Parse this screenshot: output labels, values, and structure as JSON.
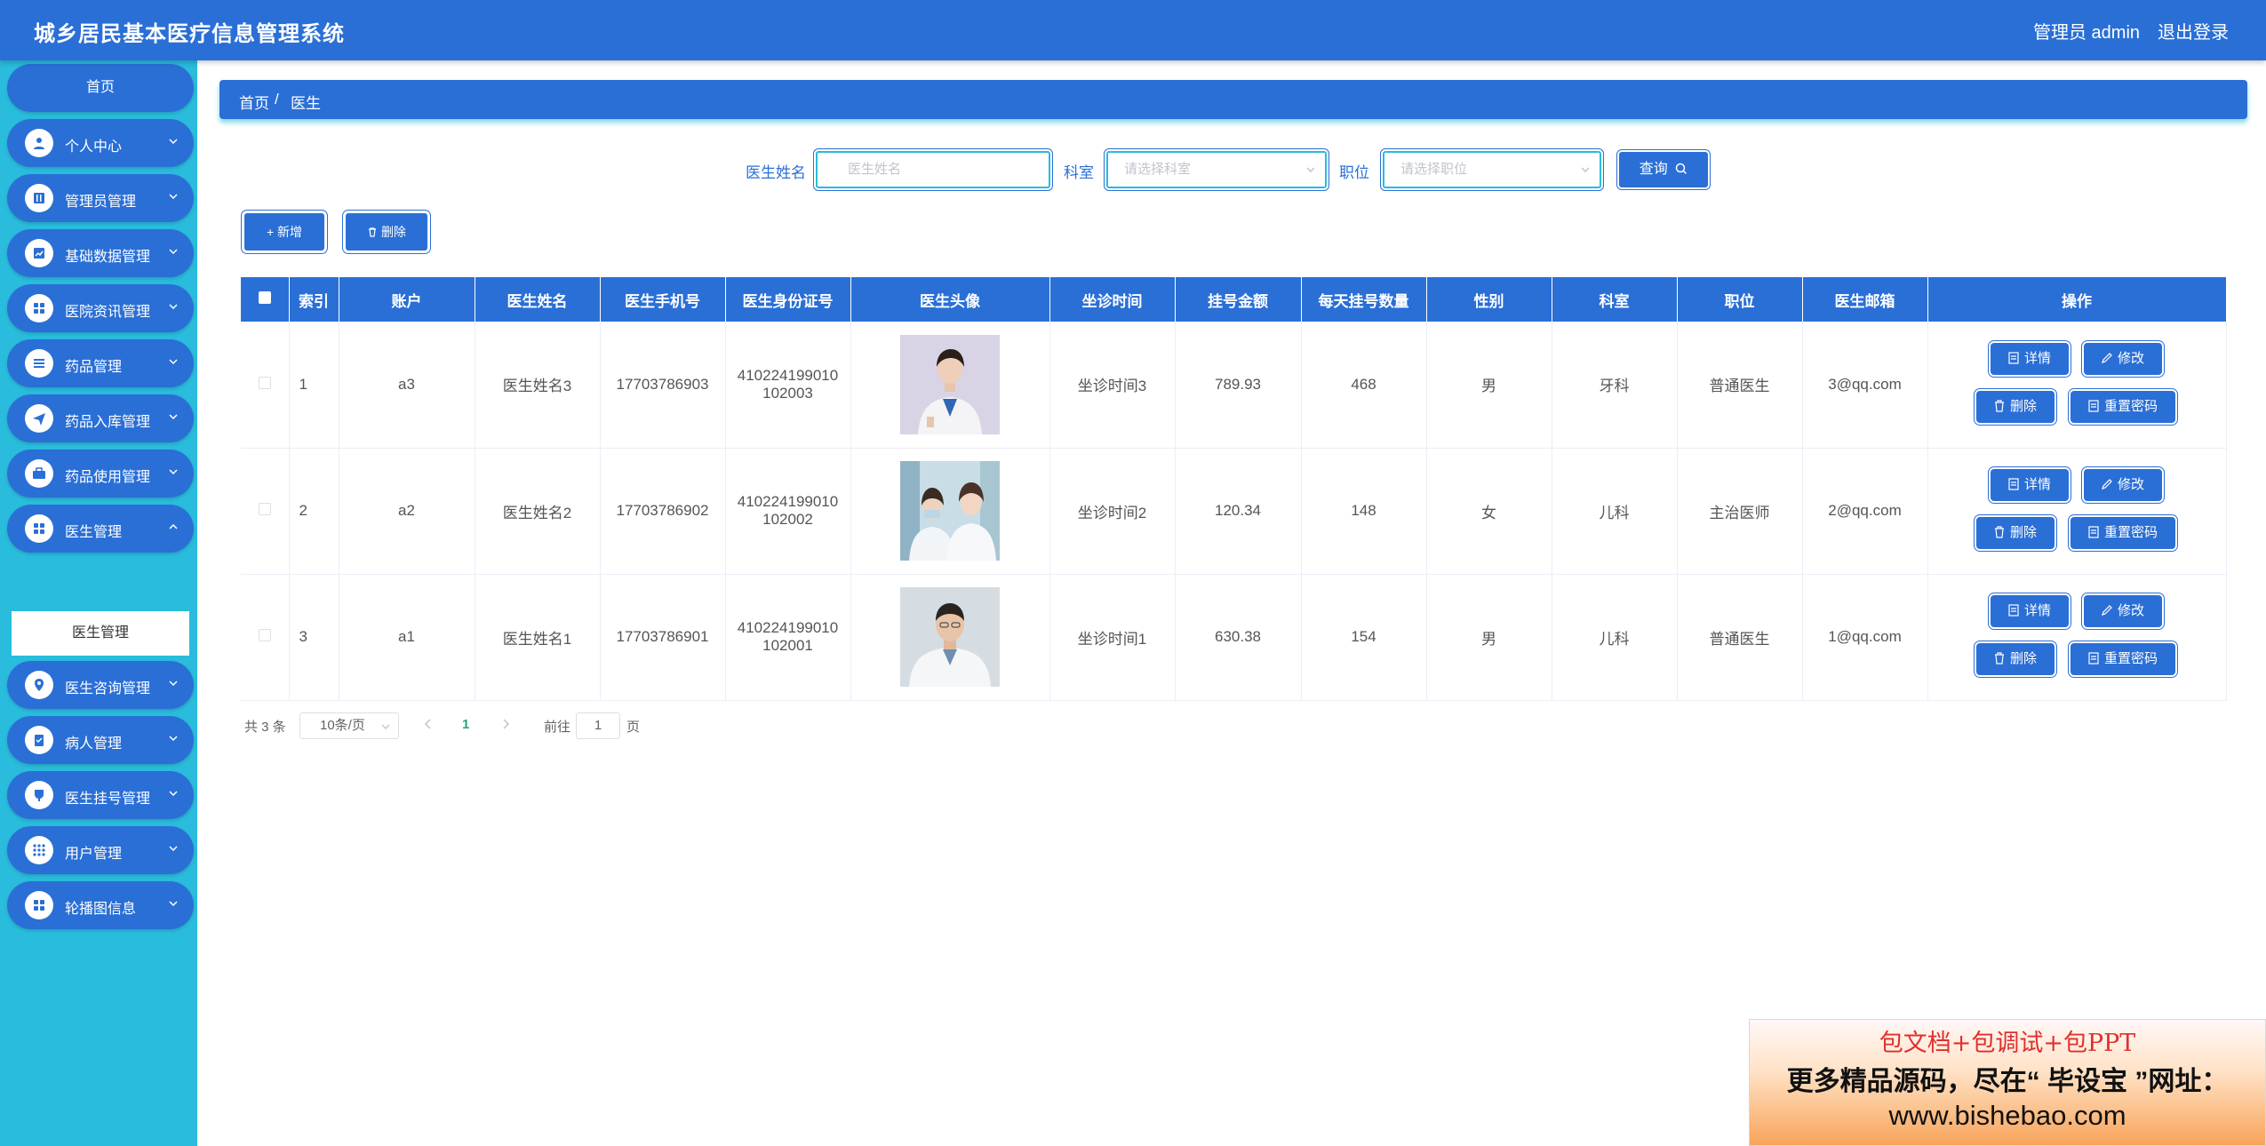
{
  "app": {
    "title": "城乡居民基本医疗信息管理系统",
    "admin_label": "管理员 admin",
    "logout_label": "退出登录"
  },
  "sidebar": {
    "home_label": "首页",
    "items": [
      {
        "label": "个人中心",
        "icon": "user-icon"
      },
      {
        "label": "管理员管理",
        "icon": "book-icon"
      },
      {
        "label": "基础数据管理",
        "icon": "chart-icon"
      },
      {
        "label": "医院资讯管理",
        "icon": "grid-icon"
      },
      {
        "label": "药品管理",
        "icon": "sliders-icon"
      },
      {
        "label": "药品入库管理",
        "icon": "send-icon"
      },
      {
        "label": "药品使用管理",
        "icon": "briefcase-icon"
      },
      {
        "label": "医生管理",
        "icon": "grid-icon"
      },
      {
        "label": "医生咨询管理",
        "icon": "location-icon"
      },
      {
        "label": "病人管理",
        "icon": "clipboard-icon"
      },
      {
        "label": "医生挂号管理",
        "icon": "cup-icon"
      },
      {
        "label": "用户管理",
        "icon": "apps-icon"
      },
      {
        "label": "轮播图信息",
        "icon": "grid-icon"
      }
    ],
    "active_submenu_label": "医生管理"
  },
  "breadcrumb": {
    "home": "首页",
    "separator": "/",
    "current": "医生"
  },
  "search": {
    "name_label": "医生姓名",
    "name_placeholder": "医生姓名",
    "dept_label": "科室",
    "dept_placeholder": "请选择科室",
    "position_label": "职位",
    "position_placeholder": "请选择职位",
    "query_label": "查询"
  },
  "actions": {
    "add_label": "新增",
    "delete_label": "删除"
  },
  "table": {
    "headers": [
      "索引",
      "账户",
      "医生姓名",
      "医生手机号",
      "医生身份证号",
      "医生头像",
      "坐诊时间",
      "挂号金额",
      "每天挂号数量",
      "性别",
      "科室",
      "职位",
      "医生邮箱",
      "操作"
    ],
    "rows": [
      {
        "index": "1",
        "account": "a3",
        "name": "医生姓名3",
        "phone": "17703786903",
        "id_line1": "410224199010",
        "id_line2": "102003",
        "avatar": "female-doctor-photo",
        "time": "坐诊时间3",
        "fee": "789.93",
        "daily": "468",
        "gender": "男",
        "dept": "牙科",
        "position": "普通医生",
        "email": "3@qq.com"
      },
      {
        "index": "2",
        "account": "a2",
        "name": "医生姓名2",
        "phone": "17703786902",
        "id_line1": "410224199010",
        "id_line2": "102002",
        "avatar": "two-doctors-photo",
        "time": "坐诊时间2",
        "fee": "120.34",
        "daily": "148",
        "gender": "女",
        "dept": "儿科",
        "position": "主治医师",
        "email": "2@qq.com"
      },
      {
        "index": "3",
        "account": "a1",
        "name": "医生姓名1",
        "phone": "17703786901",
        "id_line1": "410224199010",
        "id_line2": "102001",
        "avatar": "male-doctor-photo",
        "time": "坐诊时间1",
        "fee": "630.38",
        "daily": "154",
        "gender": "男",
        "dept": "儿科",
        "position": "普通医生",
        "email": "1@qq.com"
      }
    ],
    "op_labels": {
      "detail": "详情",
      "edit": "修改",
      "delete": "删除",
      "reset": "重置密码"
    }
  },
  "pagination": {
    "total": "共 3 条",
    "page_size": "10条/页",
    "current_page": "1",
    "goto_label": "前往",
    "goto_value": "1",
    "page_suffix": "页"
  },
  "ad": {
    "line1": "包文档+包调试+包PPT",
    "line2": "更多精品源码，尽在“ 毕设宝 ”网址：",
    "line3": "www.bishebao.com"
  },
  "colors": {
    "primary": "#2a6fd6",
    "sidebar_bg": "#29bcdc",
    "active_page": "#29a380"
  }
}
